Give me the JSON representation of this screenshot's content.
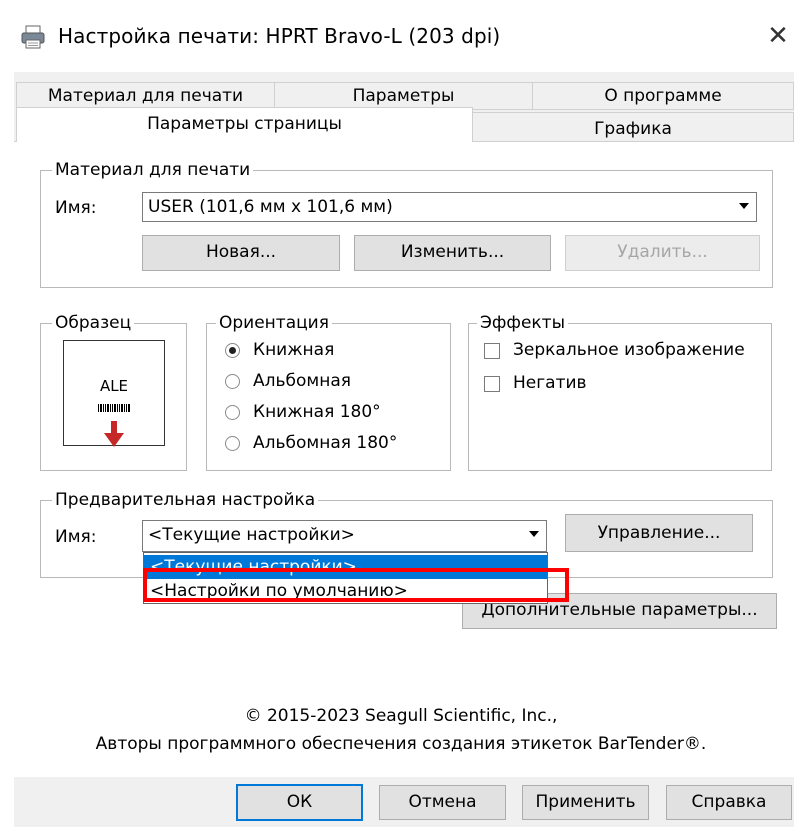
{
  "window": {
    "title": "Настройка печати: HPRT Bravo-L (203 dpi)",
    "close_symbol": "✕"
  },
  "tabs": {
    "back": [
      "Материал для печати",
      "Параметры",
      "О программе"
    ],
    "front": [
      "Параметры страницы",
      "Графика"
    ],
    "active": "Параметры страницы"
  },
  "media": {
    "group_label": "Материал для печати",
    "name_label": "Имя:",
    "name_value": "USER (101,6 мм x 101,6 мм)",
    "new_button": "Новая...",
    "edit_button": "Изменить...",
    "delete_button": "Удалить..."
  },
  "sample": {
    "group_label": "Образец",
    "preview_text": "ALE"
  },
  "orientation": {
    "group_label": "Ориентация",
    "options": [
      "Книжная",
      "Альбомная",
      "Книжная 180°",
      "Альбомная 180°"
    ],
    "selected": "Книжная"
  },
  "effects": {
    "group_label": "Эффекты",
    "mirror": "Зеркальное изображение",
    "negative": "Негатив"
  },
  "preset": {
    "group_label": "Предварительная настройка",
    "name_label": "Имя:",
    "name_value": "<Текущие настройки>",
    "manage_button": "Управление...",
    "dropdown_options": [
      "<Текущие настройки>",
      "<Настройки по умолчанию>"
    ],
    "dropdown_selected": "<Текущие настройки>"
  },
  "advanced_button": "Дополнительные параметры...",
  "copyright": {
    "line1": "© 2015-2023 Seagull Scientific, Inc.,",
    "line2": "Авторы программного обеспечения создания этикеток BarTender®."
  },
  "footer": {
    "ok": "ОК",
    "cancel": "Отмена",
    "apply": "Применить",
    "help": "Справка"
  },
  "colors": {
    "selection": "#0078d7",
    "highlight_box": "#ff0000",
    "arrow": "#c62828"
  }
}
